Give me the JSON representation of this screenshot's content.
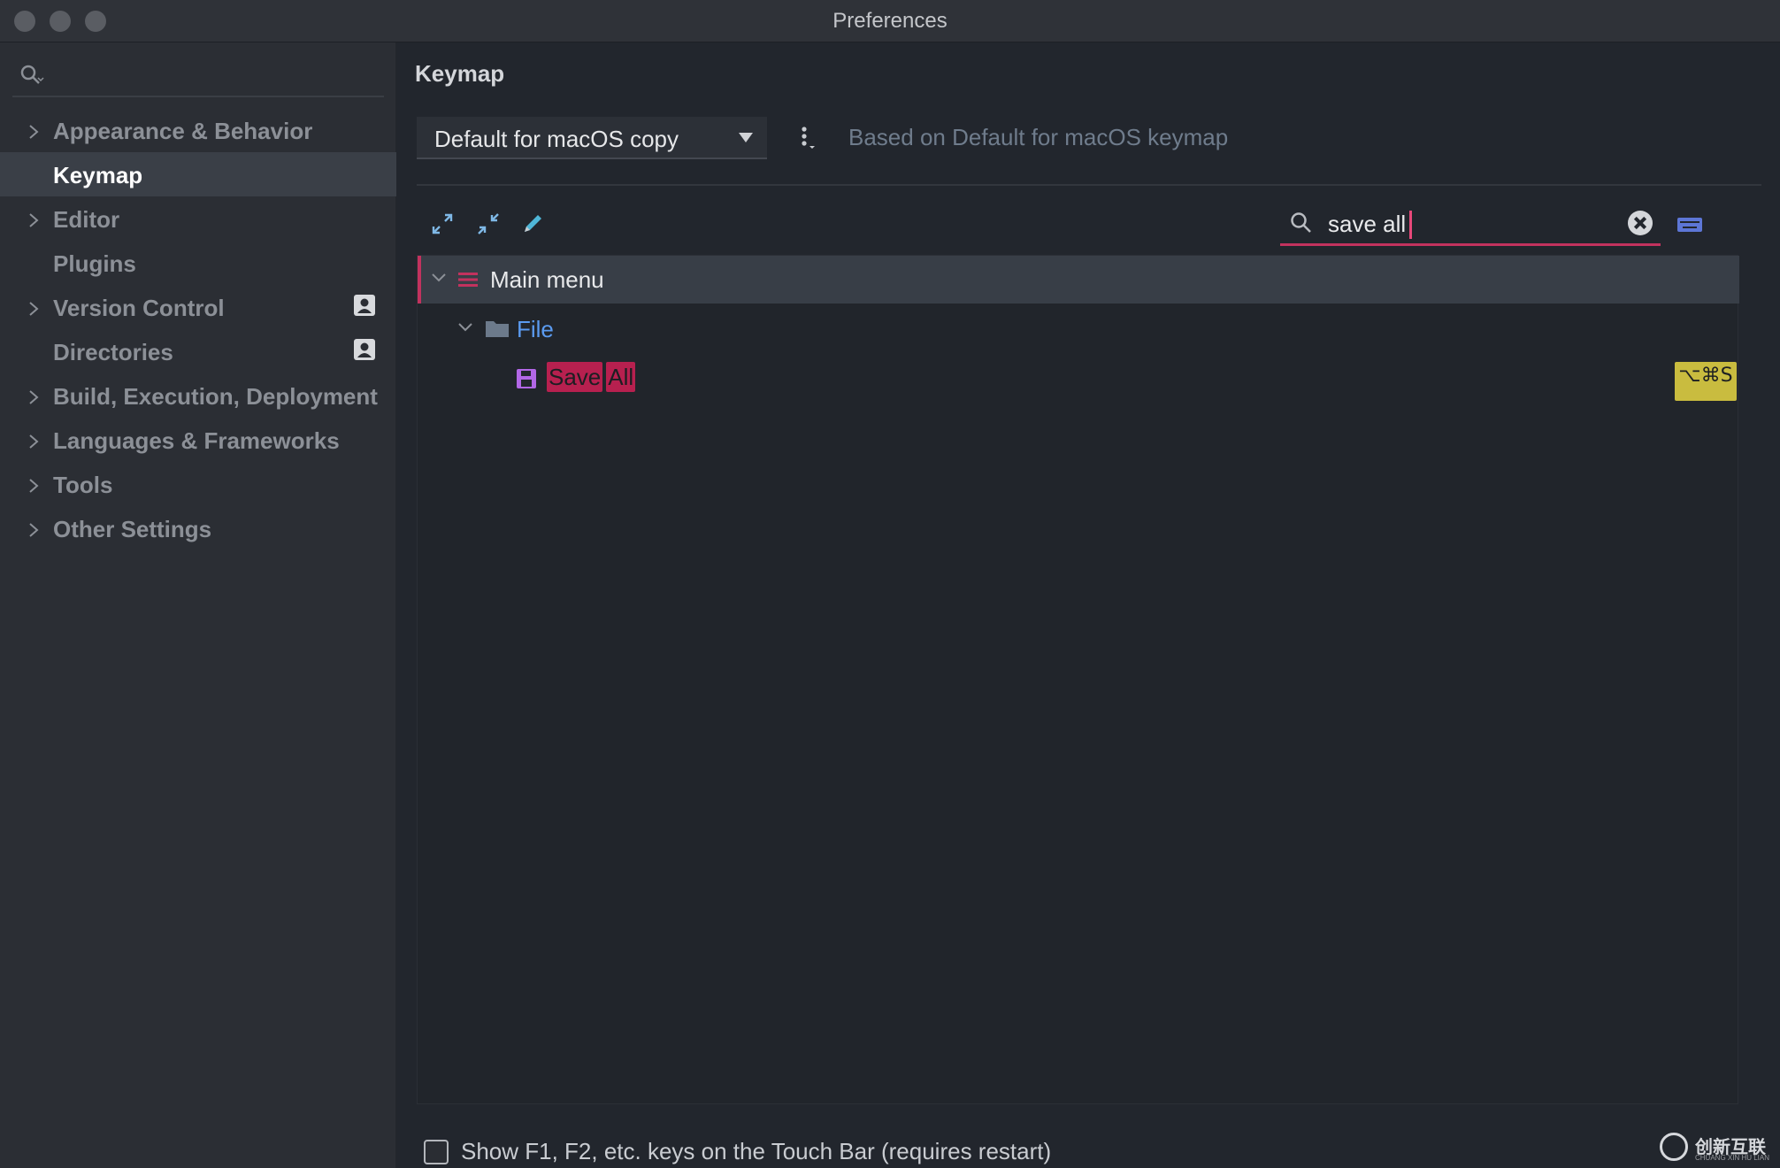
{
  "window": {
    "title": "Preferences"
  },
  "sidebar": {
    "search": {
      "value": "",
      "placeholder": ""
    },
    "items": [
      {
        "label": "Appearance & Behavior",
        "expandable": true,
        "active": false,
        "badge": false
      },
      {
        "label": "Keymap",
        "expandable": false,
        "active": true,
        "badge": false
      },
      {
        "label": "Editor",
        "expandable": true,
        "active": false,
        "badge": false
      },
      {
        "label": "Plugins",
        "expandable": false,
        "active": false,
        "badge": false
      },
      {
        "label": "Version Control",
        "expandable": true,
        "active": false,
        "badge": true
      },
      {
        "label": "Directories",
        "expandable": false,
        "active": false,
        "badge": true
      },
      {
        "label": "Build, Execution, Deployment",
        "expandable": true,
        "active": false,
        "badge": false
      },
      {
        "label": "Languages & Frameworks",
        "expandable": true,
        "active": false,
        "badge": false
      },
      {
        "label": "Tools",
        "expandable": true,
        "active": false,
        "badge": false
      },
      {
        "label": "Other Settings",
        "expandable": true,
        "active": false,
        "badge": false
      }
    ]
  },
  "main": {
    "section_title": "Keymap",
    "keymap_select": {
      "value": "Default for macOS copy"
    },
    "based_on": "Based on Default for macOS keymap",
    "filter": {
      "value": "save all"
    },
    "tree": {
      "root_label": "Main menu",
      "group_label": "File",
      "action": {
        "highlight_words": [
          "Save",
          "All"
        ],
        "shortcut": "⌥⌘S"
      }
    },
    "touchbar_label": "Show F1, F2, etc. keys on the Touch Bar (requires restart)"
  },
  "colors": {
    "accent": "#c2325e",
    "selection_bg": "#383e47",
    "shortcut_bg": "#c9bc3f",
    "link": "#6f7c8c",
    "folder": "#6c7a8b"
  },
  "icons": [
    "search-icon",
    "chevron-right-icon",
    "user-badge-icon",
    "dropdown-arrow-icon",
    "more-vertical-icon",
    "expand-all-icon",
    "collapse-all-icon",
    "edit-pencil-icon",
    "clear-icon",
    "keyboard-icon",
    "chevron-down-icon",
    "menu-icon",
    "folder-icon",
    "save-icon"
  ],
  "watermark": {
    "text": "创新互联",
    "subtext": "CHUANG XIN HU LIAN"
  }
}
